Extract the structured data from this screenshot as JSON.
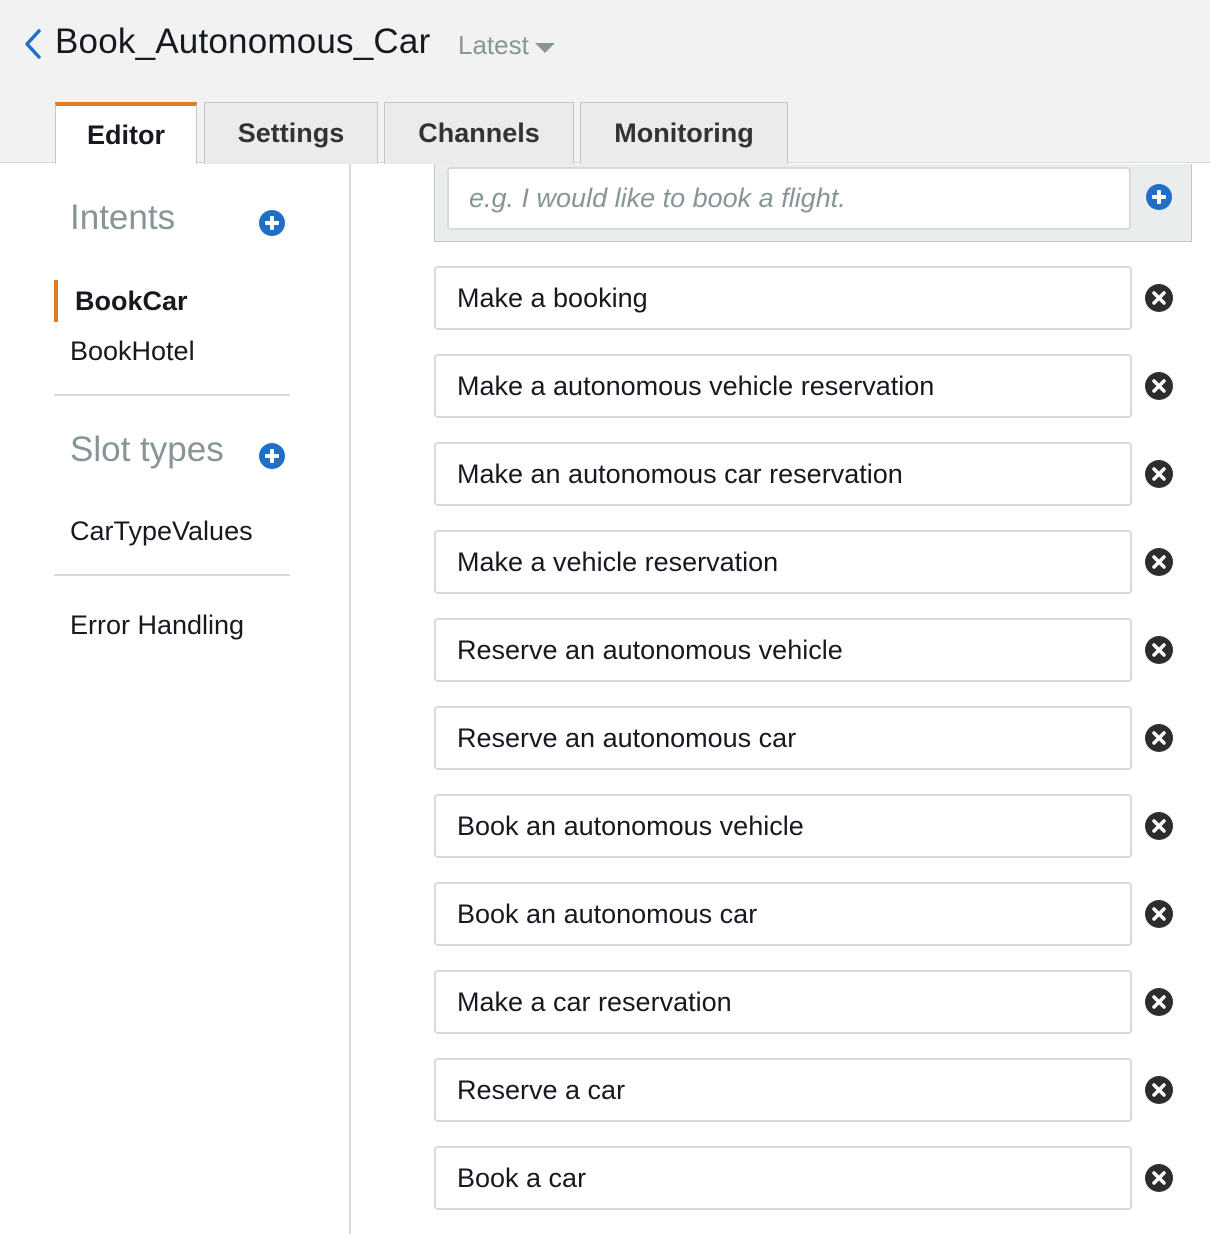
{
  "header": {
    "bot_name": "Book_Autonomous_Car",
    "version_label": "Latest",
    "tabs": [
      {
        "label": "Editor",
        "active": true
      },
      {
        "label": "Settings",
        "active": false
      },
      {
        "label": "Channels",
        "active": false
      },
      {
        "label": "Monitoring",
        "active": false
      }
    ]
  },
  "sidebar": {
    "intents_heading": "Intents",
    "intents": [
      {
        "label": "BookCar",
        "active": true
      },
      {
        "label": "BookHotel",
        "active": false
      }
    ],
    "slot_types_heading": "Slot types",
    "slot_types": [
      {
        "label": "CarTypeValues"
      }
    ],
    "error_handling_label": "Error Handling"
  },
  "utterances": {
    "new_placeholder": "e.g. I would like to book a flight.",
    "items": [
      "Make a booking",
      "Make a autonomous vehicle reservation",
      "Make an autonomous car reservation",
      "Make a vehicle reservation",
      "Reserve an autonomous vehicle",
      "Reserve an autonomous car",
      "Book an autonomous vehicle",
      "Book an autonomous car",
      "Make a car reservation",
      "Reserve a car",
      "Book a car"
    ]
  },
  "colors": {
    "accent_orange": "#e07b2a",
    "add_icon_blue": "#1f6fc6",
    "remove_icon_dark": "#2d2d2d",
    "header_bg": "#f2f2f2"
  },
  "icons": {
    "back": "chevron-left-icon",
    "version_dropdown": "caret-down-icon",
    "add": "plus-circle-icon",
    "remove": "x-circle-icon"
  }
}
